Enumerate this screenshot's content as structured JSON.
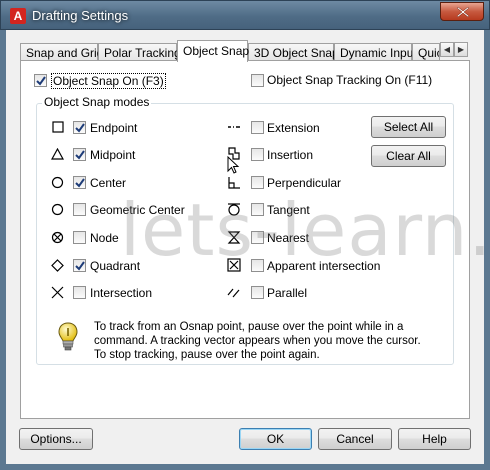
{
  "window": {
    "title": "Drafting Settings",
    "app_icon": "A"
  },
  "tabs": [
    {
      "label": "Snap and Grid"
    },
    {
      "label": "Polar Tracking"
    },
    {
      "label": "Object Snap"
    },
    {
      "label": "3D Object Snap"
    },
    {
      "label": "Dynamic Input"
    },
    {
      "label": "Quic"
    }
  ],
  "active_tab": "Object Snap",
  "top_options": {
    "snap_on": {
      "label": "Object Snap On (F3)",
      "checked": true
    },
    "tracking_on": {
      "label": "Object Snap Tracking On (F11)",
      "checked": false
    }
  },
  "modes_group_title": "Object Snap modes",
  "modes_left": [
    {
      "label": "Endpoint",
      "checked": true,
      "icon": "endpoint-square"
    },
    {
      "label": "Midpoint",
      "checked": true,
      "icon": "midpoint-triangle"
    },
    {
      "label": "Center",
      "checked": true,
      "icon": "center-circle"
    },
    {
      "label": "Geometric Center",
      "checked": false,
      "icon": "geometric-center-circle"
    },
    {
      "label": "Node",
      "checked": false,
      "icon": "node-circle-x"
    },
    {
      "label": "Quadrant",
      "checked": true,
      "icon": "quadrant-diamond"
    },
    {
      "label": "Intersection",
      "checked": false,
      "icon": "intersection-x"
    }
  ],
  "modes_right": [
    {
      "label": "Extension",
      "checked": false,
      "icon": "extension-dashes"
    },
    {
      "label": "Insertion",
      "checked": false,
      "icon": "insertion-square"
    },
    {
      "label": "Perpendicular",
      "checked": false,
      "icon": "perpendicular"
    },
    {
      "label": "Tangent",
      "checked": false,
      "icon": "tangent-circle"
    },
    {
      "label": "Nearest",
      "checked": false,
      "icon": "nearest-hourglass"
    },
    {
      "label": "Apparent intersection",
      "checked": false,
      "icon": "apparent-intersection-box"
    },
    {
      "label": "Parallel",
      "checked": false,
      "icon": "parallel-lines"
    }
  ],
  "buttons": {
    "select_all": "Select All",
    "clear_all": "Clear All",
    "options": "Options...",
    "ok": "OK",
    "cancel": "Cancel",
    "help": "Help"
  },
  "info": {
    "line1": "To track from an Osnap point, pause over the point while in a",
    "line2": "command.  A tracking vector appears when you move the cursor.",
    "line3": "To stop tracking, pause over the point again."
  },
  "watermark": "lets-learn.ir"
}
